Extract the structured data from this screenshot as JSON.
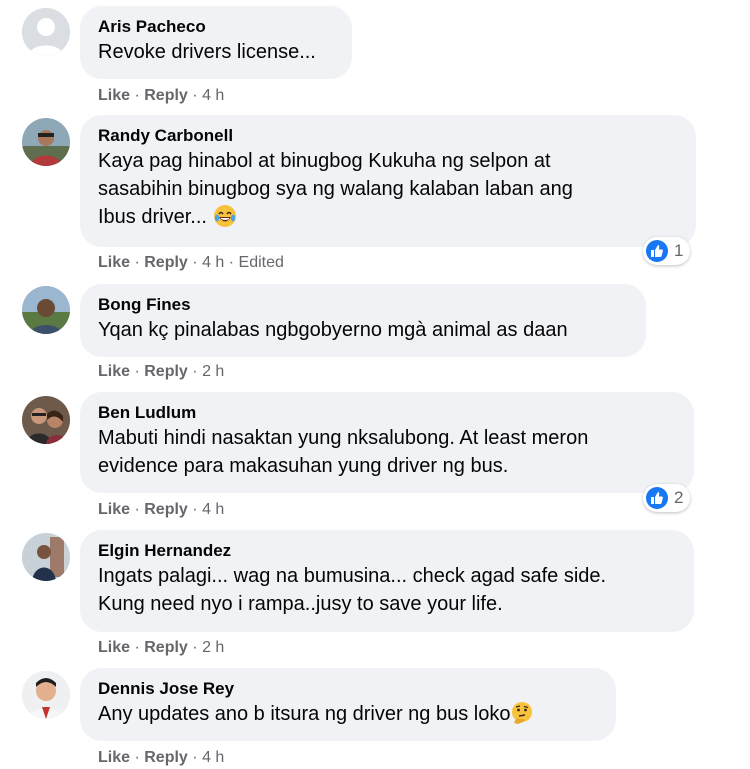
{
  "comments": [
    {
      "author": "Aris Pacheco",
      "lines": [
        "Revoke drivers license..."
      ],
      "like": "Like",
      "reply": "Reply",
      "time": "4 h"
    },
    {
      "author": "Randy Carbonell",
      "lines": [
        "Kaya pag hinabol at binugbog Kukuha ng selpon at",
        "sasabihin binugbog sya ng walang kalaban laban ang",
        "Ibus driver..."
      ],
      "like": "Like",
      "reply": "Reply",
      "time": "4 h",
      "edited": "Edited",
      "reaction_count": "1",
      "emoji": "laughing-tears-emoji"
    },
    {
      "author": "Bong Fines",
      "lines": [
        "Yqan kç pinalabas ngbgobyerno mgà animal as daan"
      ],
      "like": "Like",
      "reply": "Reply",
      "time": "2 h"
    },
    {
      "author": "Ben Ludlum",
      "lines": [
        "Mabuti hindi nasaktan yung nksalubong. At least meron",
        "evidence para makasuhan yung driver ng bus."
      ],
      "like": "Like",
      "reply": "Reply",
      "time": "4 h",
      "reaction_count": "2"
    },
    {
      "author": "Elgin Hernandez",
      "lines": [
        "Ingats palagi... wag na bumusina... check agad safe side.",
        "Kung need nyo i rampa..jusy to save your life."
      ],
      "like": "Like",
      "reply": "Reply",
      "time": "2 h"
    },
    {
      "author": "Dennis Jose Rey",
      "lines": [
        "Any updates ano b itsura ng driver ng bus loko"
      ],
      "like": "Like",
      "reply": "Reply",
      "time": "4 h",
      "emoji": "thinking-face-emoji"
    }
  ],
  "separator": "·",
  "colors": {
    "bubble": "#f0f2f5",
    "meta": "#65676b",
    "like_blue": "#1877f2"
  }
}
